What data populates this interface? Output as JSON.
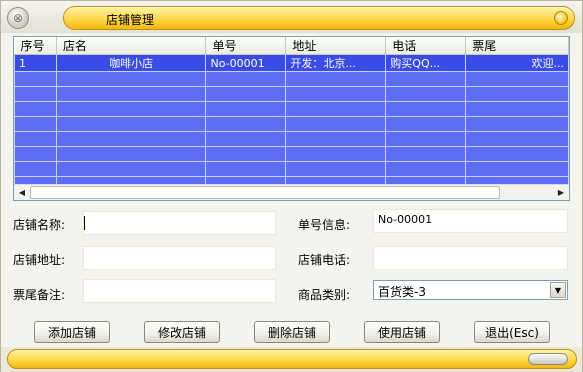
{
  "window": {
    "title": "店铺管理"
  },
  "grid": {
    "columns": [
      "序号",
      "店名",
      "单号",
      "地址",
      "电话",
      "票尾"
    ],
    "rows": [
      [
        "1",
        "咖啡小店",
        "No-00001",
        "开发：北京...",
        "购买QQ...",
        "欢迎..."
      ]
    ]
  },
  "form": {
    "shop_name_label": "店铺名称:",
    "shop_name_value": "",
    "order_info_label": "单号信息:",
    "order_info_value": "No-00001",
    "address_label": "店铺地址:",
    "address_value": "",
    "phone_label": "店铺电话:",
    "phone_value": "",
    "footer_note_label": "票尾备注:",
    "footer_note_value": "",
    "category_label": "商品类别:",
    "category_value": "百货类-3"
  },
  "buttons": {
    "add": "添加店铺",
    "edit": "修改店铺",
    "delete": "删除店铺",
    "use": "使用店铺",
    "exit": "退出(Esc)"
  },
  "colors": {
    "row_fill": "#5d6df5",
    "selected_row_fill": "#3a4ce6",
    "title_accent": "#ffd84a"
  }
}
